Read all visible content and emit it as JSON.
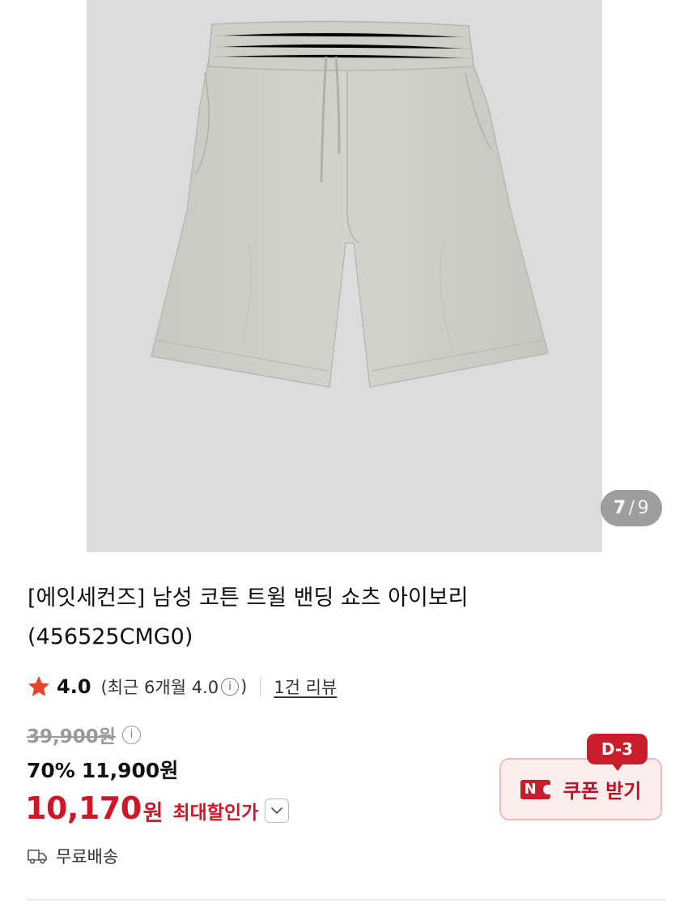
{
  "gallery": {
    "image_alt": "product-photo-shorts",
    "current": "7",
    "separator": "/",
    "total": "9"
  },
  "product": {
    "title_line1": "[에잇세컨즈] 남성 코튼 트윌 밴딩 쇼츠 아이보리",
    "title_line2": "(456525CMG0)"
  },
  "rating": {
    "star_icon": "star-icon",
    "score": "4.0",
    "recent_prefix": "(최근 6개월 4.0",
    "recent_suffix": ")",
    "info_icon_glyph": "i",
    "review_count": "1건 리뷰"
  },
  "price": {
    "original": "39,900원",
    "discount_pct": "70%",
    "sale": "11,900원",
    "max_discount_amount": "10,170",
    "max_discount_unit": "원",
    "max_discount_label": "최대할인가"
  },
  "shipping": {
    "icon": "truck-icon",
    "label": "무료배송"
  },
  "coupon": {
    "dday": "D-3",
    "badge": "N",
    "label": "쿠폰 받기"
  },
  "colors": {
    "accent_red": "#d0172a",
    "coupon_bg": "#fdeeee",
    "photo_bg": "#dcdcdc",
    "star": "#e8432f"
  }
}
